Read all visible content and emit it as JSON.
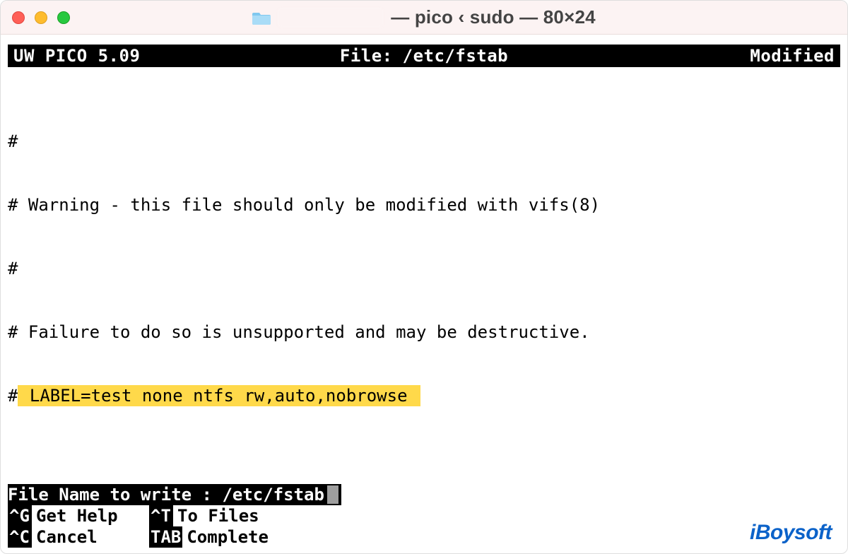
{
  "titlebar": {
    "title_suffix": "— pico ‹ sudo — 80×24"
  },
  "pico_header": {
    "left": "UW PICO 5.09",
    "center_label": "File:",
    "center_value": "/etc/fstab",
    "right": "Modified"
  },
  "editor": {
    "lines": [
      "#",
      "# Warning - this file should only be modified with vifs(8)",
      "#",
      "# Failure to do so is unsupported and may be destructive."
    ],
    "highlight_prefix": "#",
    "highlight_text": " LABEL=test none ntfs rw,auto,nobrowse "
  },
  "prompt": {
    "label": "File Name to write :",
    "value": "/etc/fstab"
  },
  "shortcuts": {
    "rows": [
      {
        "k1": "^G",
        "l1": "Get Help",
        "k2": "^T",
        "l2": "To Files"
      },
      {
        "k1": "^C",
        "l1": "Cancel",
        "k2": "TAB",
        "l2": "Complete"
      }
    ]
  },
  "watermark": "iBoysoft"
}
